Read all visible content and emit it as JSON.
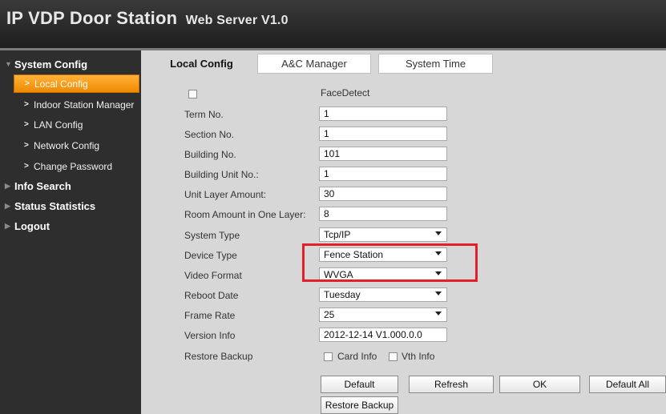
{
  "header": {
    "title": "IP VDP Door Station",
    "subtitle": "Web Server V1.0"
  },
  "colors": {
    "accent": "#f08a00",
    "highlight_border": "#e0202a",
    "sidebar_bg": "#2e2e2e",
    "content_bg": "#d7d7d7"
  },
  "sidebar": {
    "system_config": "System Config",
    "items": [
      {
        "label": "Local Config",
        "active": true
      },
      {
        "label": "Indoor Station Manager"
      },
      {
        "label": "LAN Config"
      },
      {
        "label": "Network Config"
      },
      {
        "label": "Change Password"
      }
    ],
    "info_search": "Info Search",
    "status_statistics": "Status Statistics",
    "logout": "Logout"
  },
  "tabs": [
    {
      "label": "Local Config",
      "active": true
    },
    {
      "label": "A&C Manager"
    },
    {
      "label": "System Time"
    }
  ],
  "form": {
    "face_detect": "FaceDetect",
    "term_no": {
      "label": "Term No.",
      "value": "1"
    },
    "section_no": {
      "label": "Section No.",
      "value": "1"
    },
    "building_no": {
      "label": "Building No.",
      "value": "101"
    },
    "building_unit_no": {
      "label": "Building Unit No.:",
      "value": "1"
    },
    "unit_layer_amount": {
      "label": "Unit Layer Amount:",
      "value": "30"
    },
    "room_amount": {
      "label": "Room Amount in One Layer:",
      "value": "8"
    },
    "system_type": {
      "label": "System Type",
      "value": "Tcp/IP"
    },
    "device_type": {
      "label": "Device Type",
      "value": "Fence Station"
    },
    "video_format": {
      "label": "Video Format",
      "value": "WVGA"
    },
    "reboot_date": {
      "label": "Reboot Date",
      "value": "Tuesday"
    },
    "frame_rate": {
      "label": "Frame Rate",
      "value": "25"
    },
    "version_info": {
      "label": "Version Info",
      "value": "2012-12-14 V1.000.0.0"
    },
    "restore_backup": {
      "label": "Restore Backup",
      "card_info": "Card Info",
      "vth_info": "Vth Info"
    }
  },
  "buttons": {
    "default": "Default",
    "refresh": "Refresh",
    "ok": "OK",
    "default_all": "Default All",
    "restore_backup": "Restore Backup"
  },
  "icons": {
    "collapse": "triangle-down-icon",
    "expand": "triangle-right-icon",
    "chevron": "chevron-right-icon",
    "dropdown": "caret-down-icon"
  }
}
